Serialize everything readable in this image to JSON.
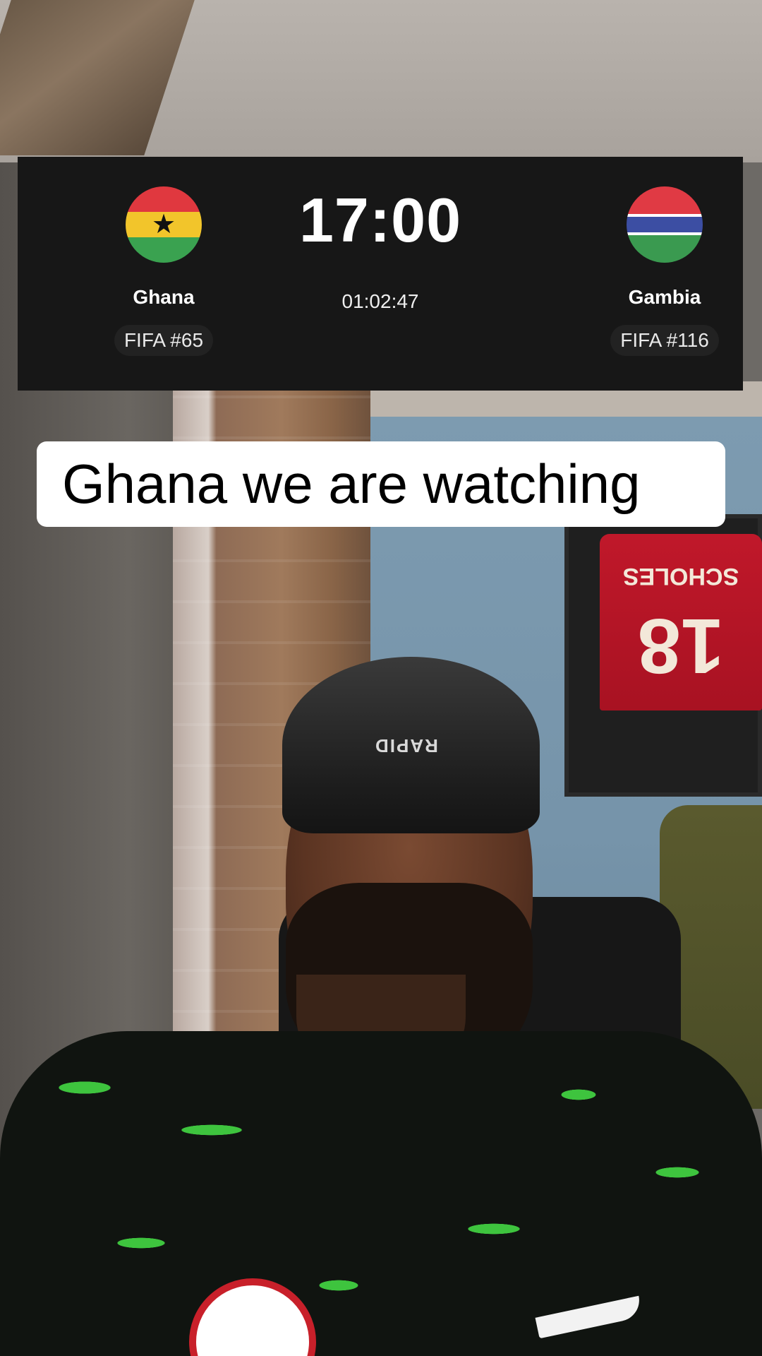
{
  "scoreboard": {
    "kickoff_time": "17:00",
    "countdown": "01:02:47",
    "home": {
      "name": "Ghana",
      "rank": "FIFA #65",
      "flag_icon": "ghana-flag-icon"
    },
    "away": {
      "name": "Gambia",
      "rank": "FIFA #116",
      "flag_icon": "gambia-flag-icon"
    },
    "background_color": "#171717"
  },
  "caption": {
    "text": "Ghana we are watching"
  },
  "scene": {
    "jersey_name": "SCHOLES",
    "jersey_number": "18",
    "durag_text": "RAPID"
  }
}
